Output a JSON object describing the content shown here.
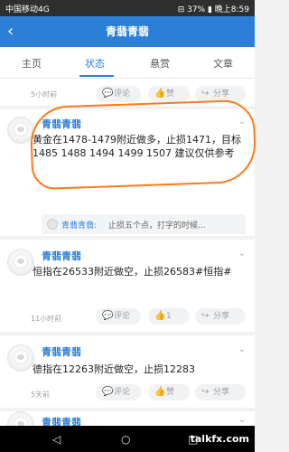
{
  "status": {
    "left": "中国移动4G",
    "right": "⊟ 37% ▮ 晚上8:59"
  },
  "header": {
    "back_glyph": "‹",
    "title": "青翡青翡"
  },
  "tabs": [
    {
      "label": "主页"
    },
    {
      "label": "状态"
    },
    {
      "label": "悬赏"
    },
    {
      "label": "文章"
    }
  ],
  "feed": {
    "first": {
      "time": "5小时前",
      "comment": "评论",
      "like": "赞",
      "share": "分享"
    },
    "post1": {
      "name": "青翡青翡",
      "text": "黄金在1478-1479附近做多，止损1471，目标1485 1488 1494 1499 1507 建议仅供参考",
      "quote_name": "青翡青翡:",
      "quote_text": "止损五个点，打字的时候..."
    },
    "post2": {
      "name": "青翡青翡",
      "text": "恒指在26533附近做空，止损26583#恒指#",
      "time": "11小时前",
      "comment": "评论",
      "like": "1",
      "share": "分享"
    },
    "post3": {
      "name": "青翡青翡",
      "text": "德指在12263附近做空，止损12283",
      "time": "5天前",
      "comment": "评论",
      "like": "赞",
      "share": "分享"
    },
    "post4": {
      "name": "青翡青翡"
    }
  },
  "nav": {
    "back": "◁",
    "home": "○",
    "recent": "□"
  },
  "watermark": "talkfx.com",
  "colors": {
    "primary": "#2b7fd7",
    "highlight": "#ff7a1a"
  }
}
